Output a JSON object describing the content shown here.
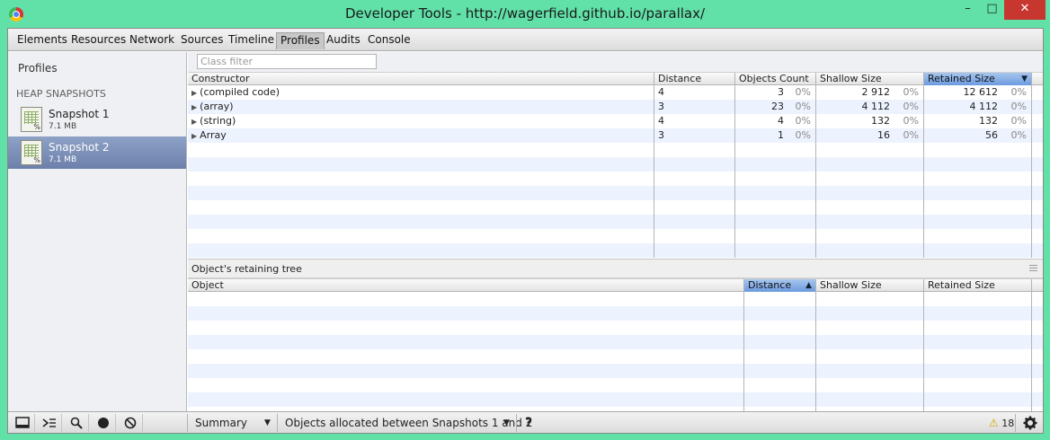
{
  "window": {
    "title": "Developer Tools - http://wagerfield.github.io/parallax/",
    "minimize": "–",
    "maximize": "□",
    "close": "✕"
  },
  "tabs": [
    "Elements",
    "Resources",
    "Network",
    "Sources",
    "Timeline",
    "Profiles",
    "Audits",
    "Console"
  ],
  "selected_tab": "Profiles",
  "sidebar": {
    "title": "Profiles",
    "section": "HEAP SNAPSHOTS",
    "snapshots": [
      {
        "name": "Snapshot 1",
        "size": "7.1 MB"
      },
      {
        "name": "Snapshot 2",
        "size": "7.1 MB"
      }
    ]
  },
  "filter": {
    "placeholder": "Class filter"
  },
  "constructors_table": {
    "headers": [
      "Constructor",
      "Distance",
      "Objects Count",
      "Shallow Size",
      "Retained Size"
    ],
    "sorted_column": "Retained Size",
    "sort_arrow": "▼",
    "rows": [
      {
        "name": "(compiled code)",
        "distance": "4",
        "count": "3",
        "count_pct": "0%",
        "shallow": "2 912",
        "shallow_pct": "0%",
        "retained": "12 612",
        "retained_pct": "0%"
      },
      {
        "name": "(array)",
        "distance": "3",
        "count": "23",
        "count_pct": "0%",
        "shallow": "4 112",
        "shallow_pct": "0%",
        "retained": "4 112",
        "retained_pct": "0%"
      },
      {
        "name": "(string)",
        "distance": "4",
        "count": "4",
        "count_pct": "0%",
        "shallow": "132",
        "shallow_pct": "0%",
        "retained": "132",
        "retained_pct": "0%"
      },
      {
        "name": "Array",
        "distance": "3",
        "count": "1",
        "count_pct": "0%",
        "shallow": "16",
        "shallow_pct": "0%",
        "retained": "56",
        "retained_pct": "0%"
      }
    ],
    "expand_glyph": "▶"
  },
  "retaining_tree": {
    "title": "Object's retaining tree",
    "headers": [
      "Object",
      "Distance",
      "Shallow Size",
      "Retained Size"
    ],
    "sorted_column": "Distance",
    "sort_arrow": "▲"
  },
  "statusbar": {
    "view": "Summary",
    "view_arrow": "▼",
    "filter": "Objects allocated between Snapshots 1 and 2",
    "filter_arrow": "▼",
    "help": "?",
    "warnings": "18",
    "warning_glyph": "⚠"
  }
}
